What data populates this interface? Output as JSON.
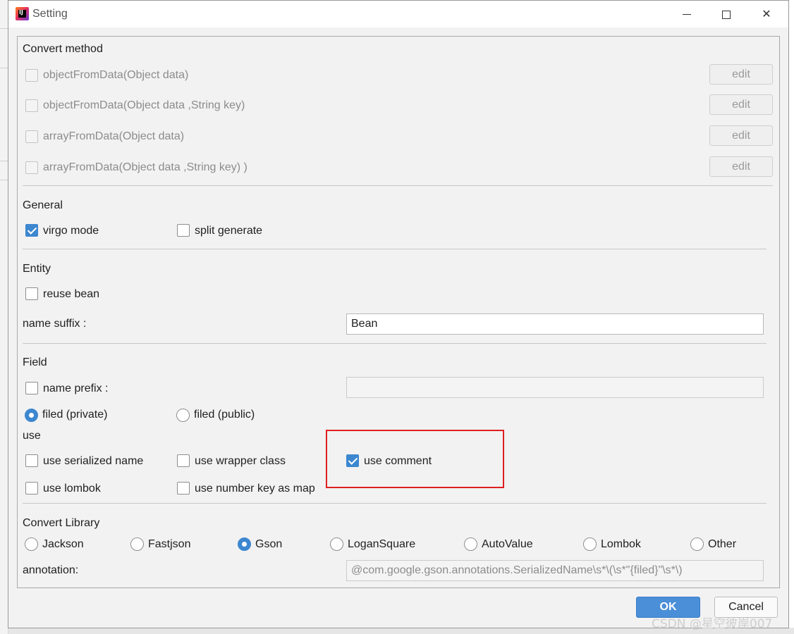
{
  "window": {
    "title": "Setting",
    "app_icon": "intellij-icon",
    "controls": {
      "minimize": "minimize-icon",
      "maximize": "maximize-icon",
      "close": "close-icon"
    }
  },
  "convert_method": {
    "heading": "Convert method",
    "methods": [
      {
        "label": "objectFromData(Object data)",
        "checked": false,
        "enabled": false,
        "button": "edit"
      },
      {
        "label": "objectFromData(Object data ,String key)",
        "checked": false,
        "enabled": false,
        "button": "edit"
      },
      {
        "label": "arrayFromData(Object data)",
        "checked": false,
        "enabled": false,
        "button": "edit"
      },
      {
        "label": "arrayFromData(Object data ,String key) )",
        "checked": false,
        "enabled": false,
        "button": "edit"
      }
    ]
  },
  "general": {
    "heading": "General",
    "virgo_mode": {
      "label": "virgo mode",
      "checked": true
    },
    "split_generate": {
      "label": "split generate",
      "checked": false
    }
  },
  "entity": {
    "heading": "Entity",
    "reuse_bean": {
      "label": "reuse bean",
      "checked": false
    },
    "name_suffix_label": "name suffix :",
    "name_suffix_value": "Bean"
  },
  "field": {
    "heading": "Field",
    "name_prefix": {
      "label": "name prefix :",
      "checked": false,
      "value": ""
    },
    "filed_private": {
      "label": "filed (private)",
      "selected": true
    },
    "filed_public": {
      "label": "filed (public)",
      "selected": false
    },
    "use_heading": "use",
    "use_serialized_name": {
      "label": "use serialized name",
      "checked": false
    },
    "use_wrapper_class": {
      "label": "use wrapper class",
      "checked": false
    },
    "use_comment": {
      "label": "use comment",
      "checked": true
    },
    "use_lombok": {
      "label": "use lombok",
      "checked": false
    },
    "use_number_key_as_map": {
      "label": "use number key as map",
      "checked": false
    }
  },
  "convert_library": {
    "heading": "Convert Library",
    "options": [
      {
        "label": "Jackson",
        "selected": false
      },
      {
        "label": "Fastjson",
        "selected": false
      },
      {
        "label": "Gson",
        "selected": true
      },
      {
        "label": "LoganSquare",
        "selected": false
      },
      {
        "label": "AutoValue",
        "selected": false
      },
      {
        "label": "Lombok",
        "selected": false
      },
      {
        "label": "Other",
        "selected": false
      }
    ],
    "annotation_label": "annotation:",
    "annotation_value": "@com.google.gson.annotations.SerializedName\\s*\\(\\s*\"{filed}\"\\s*\\)"
  },
  "footer": {
    "ok": "OK",
    "cancel": "Cancel"
  },
  "watermark": "CSDN @星空彼岸007",
  "colors": {
    "accent": "#3c87d0",
    "highlight_box": "#e02020",
    "ok_button": "#4a8fd8"
  }
}
